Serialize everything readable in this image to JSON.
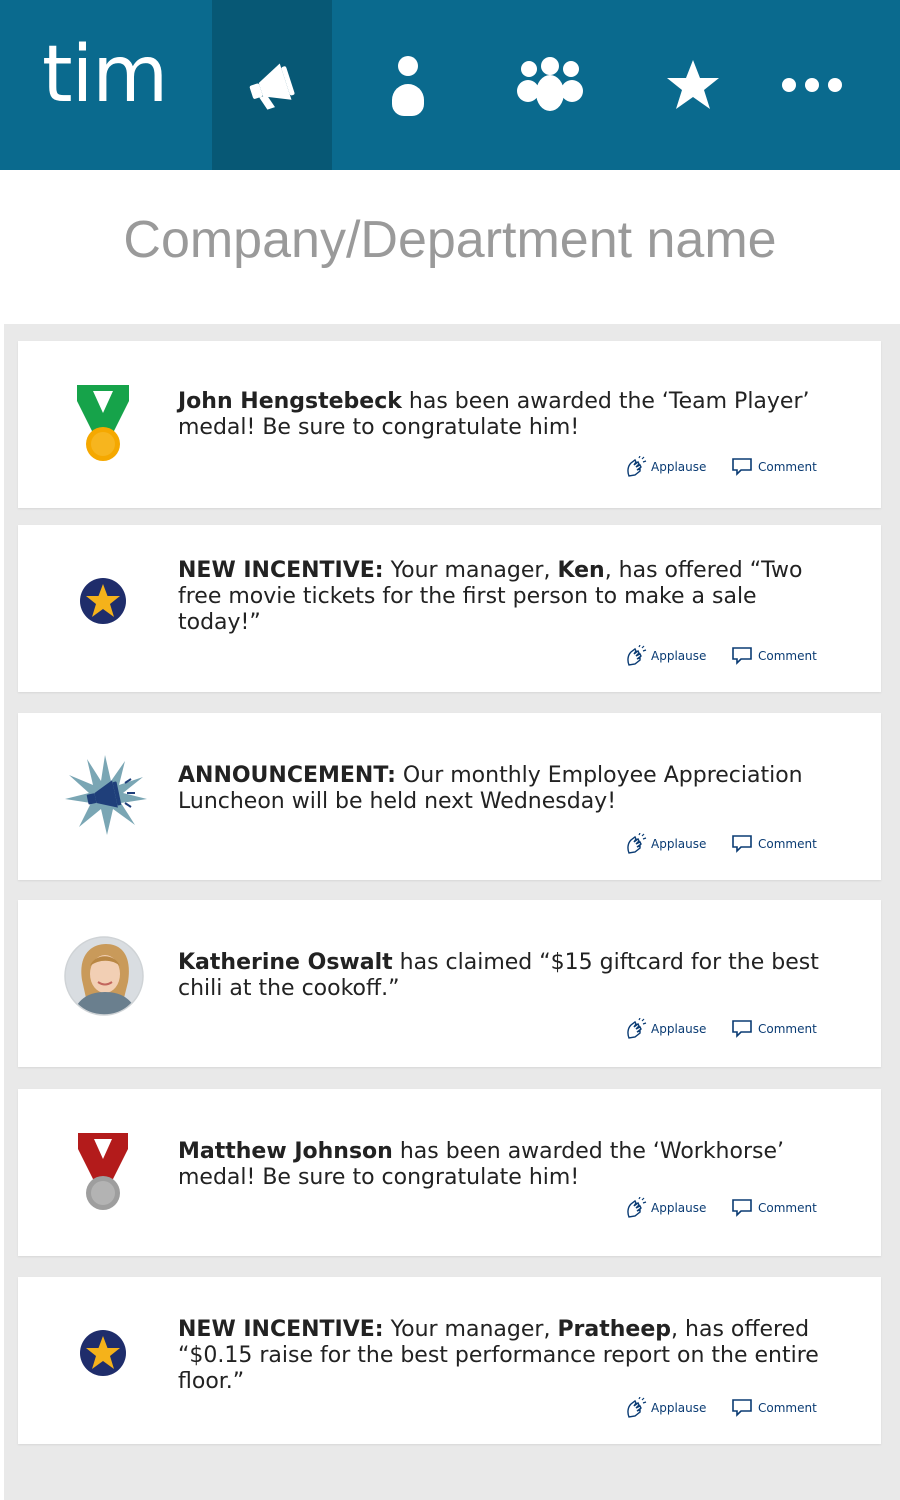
{
  "app": {
    "logo": "tim",
    "brand_color": "#0a6a8e"
  },
  "nav": {
    "tabs": [
      {
        "icon": "megaphone-icon",
        "active": true
      },
      {
        "icon": "person-icon",
        "active": false
      },
      {
        "icon": "group-icon",
        "active": false
      },
      {
        "icon": "star-icon",
        "active": false
      },
      {
        "icon": "more-icon",
        "active": false
      }
    ]
  },
  "page": {
    "title": "Company/Department name"
  },
  "actions": {
    "applause": "Applause",
    "comment": "Comment"
  },
  "feed": [
    {
      "icon": "green-medal-icon",
      "bold": "John Hengstebeck",
      "text": " has been awarded the ‘Team Player’ medal! Be sure to congratulate him!"
    },
    {
      "icon": "incentive-star-icon",
      "prefix": "NEW INCENTIVE:",
      "pre": "  Your manager, ",
      "bold": "Ken",
      "text": ", has offered “Two free movie tickets for the first person to make a sale today!”"
    },
    {
      "icon": "announcement-burst-icon",
      "prefix": "ANNOUNCEMENT:",
      "text": "  Our monthly Employee Appreciation Luncheon will be held next Wednesday!"
    },
    {
      "icon": "avatar-photo",
      "bold": "Katherine Oswalt",
      "text": " has claimed “$15 giftcard for the best chili at the cookoff.”"
    },
    {
      "icon": "red-medal-icon",
      "bold": "Matthew Johnson",
      "text": " has been awarded the ‘Workhorse’ medal! Be sure to congratulate him!"
    },
    {
      "icon": "incentive-star-icon",
      "prefix": "NEW INCENTIVE:",
      "pre": "  Your manager, ",
      "bold": "Pratheep",
      "text": ", has offered “$0.15 raise for the best performance report on the entire floor.”"
    }
  ]
}
